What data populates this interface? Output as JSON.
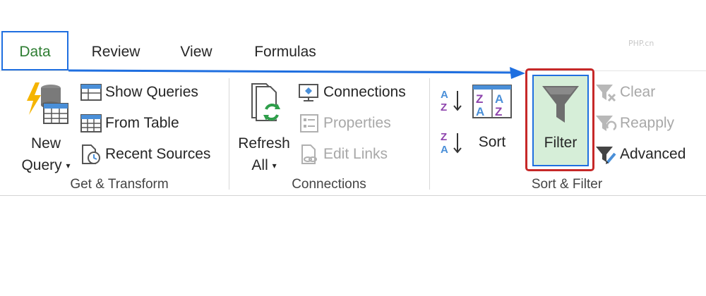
{
  "watermark": "PHP.cn",
  "tabs": [
    {
      "label": "Data",
      "selected": true
    },
    {
      "label": "Review"
    },
    {
      "label": "View"
    },
    {
      "label": "Formulas"
    }
  ],
  "groups": {
    "get_transform": {
      "label": "Get & Transform",
      "new_query": {
        "line1": "New",
        "line2": "Query"
      },
      "show_queries": "Show Queries",
      "from_table": "From Table",
      "recent_sources": "Recent Sources"
    },
    "connections": {
      "label": "Connections",
      "refresh_all": {
        "line1": "Refresh",
        "line2": "All"
      },
      "connections": "Connections",
      "properties": "Properties",
      "edit_links": "Edit Links"
    },
    "sort_filter": {
      "label": "Sort & Filter",
      "sort_az": "A→Z",
      "sort_za": "Z→A",
      "sort": "Sort",
      "filter": "Filter",
      "clear": "Clear",
      "reapply": "Reapply",
      "advanced": "Advanced"
    }
  },
  "colors": {
    "highlight_blue": "#1f6fe0",
    "highlight_red": "#c62828",
    "filter_bg": "#d6eed8",
    "data_tab_text": "#2e7d32"
  }
}
